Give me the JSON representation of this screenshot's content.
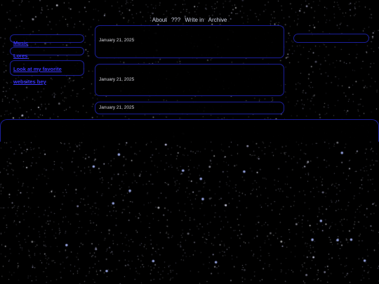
{
  "nav": {
    "items": [
      {
        "label": "About"
      },
      {
        "label": "???"
      },
      {
        "label": "Write in"
      },
      {
        "label": "Archive"
      }
    ]
  },
  "sidebar": {
    "links": [
      {
        "label": "Music"
      },
      {
        "label": "Lores"
      },
      {
        "label": "Look at my favorite websites hey"
      }
    ]
  },
  "posts": [
    {
      "date": "January 21, 2025"
    },
    {
      "date": "January 21, 2025"
    },
    {
      "date": "January 21, 2025"
    }
  ],
  "colors": {
    "background": "#000000",
    "panel_border": "#1b1f9c",
    "link": "#3a36ff",
    "nav_text": "#cfd3e6"
  }
}
